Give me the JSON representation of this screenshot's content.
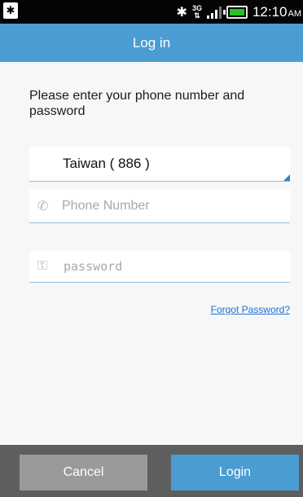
{
  "status_bar": {
    "left_icon": "bluetooth-badge-icon",
    "network_type": "3G",
    "time": "12:10",
    "ampm": "AM",
    "colors": {
      "battery_fill": "#27c127"
    }
  },
  "header": {
    "title": "Log in",
    "color": "#4a9cd3"
  },
  "form": {
    "prompt": "Please enter your phone number and password",
    "country": "Taiwan ( 886 )",
    "phone": {
      "placeholder": "Phone Number",
      "value": "",
      "icon": "phone-icon"
    },
    "password": {
      "placeholder": "password",
      "value": "",
      "icon": "key-icon"
    },
    "forgot_link": "Forgot Password?"
  },
  "actions": {
    "cancel_label": "Cancel",
    "login_label": "Login"
  }
}
